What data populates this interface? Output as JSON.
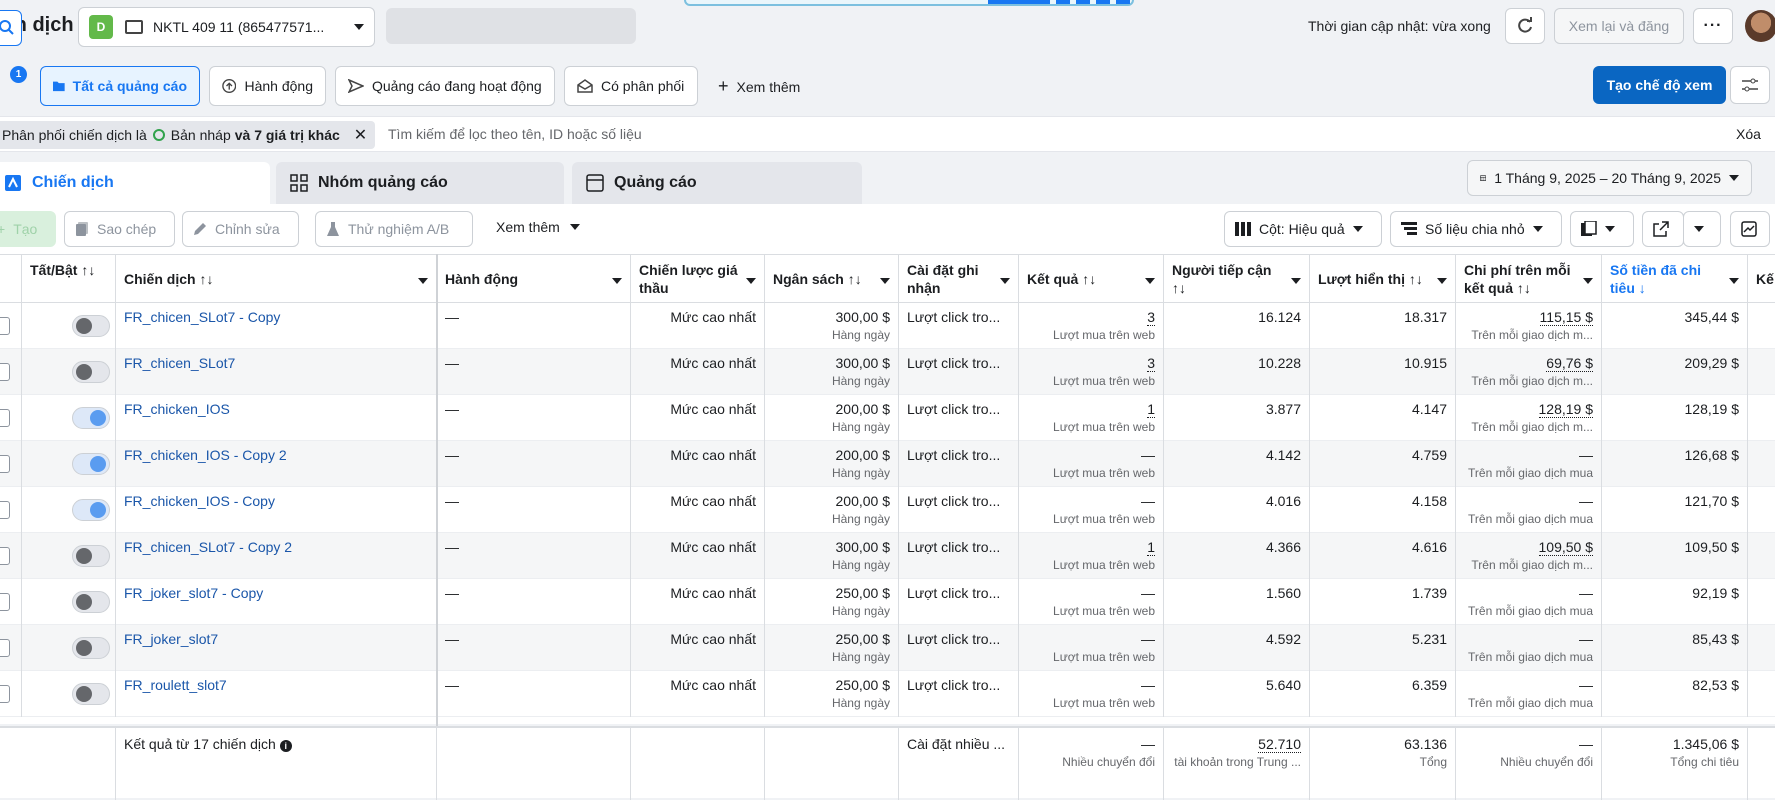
{
  "header": {
    "title": "iến dịch",
    "account_badge": "D",
    "account_name": "NKTL 409 11 (865477571...",
    "updated_text": "Thời gian cập nhật: vừa xong",
    "review_label": "Xem lại và đăng"
  },
  "toolbar": {
    "notif_count": "1",
    "chips": [
      "Tất cả quảng cáo",
      "Hành động",
      "Quảng cáo đang hoạt động",
      "Có phân phối"
    ],
    "more_label": "Xem thêm",
    "create_view_label": "Tạo chế độ xem"
  },
  "filter": {
    "text": "Phân phối chiến dịch là",
    "value": "Bản nháp",
    "extra": "và 7 giá trị khác",
    "search_placeholder": "Tìm kiếm để lọc theo tên, ID hoặc số liệu",
    "clear_label": "Xóa"
  },
  "tabs": [
    "Chiến dịch",
    "Nhóm quảng cáo",
    "Quảng cáo"
  ],
  "date_range": "1 Tháng 9, 2025 – 20 Tháng 9, 2025",
  "actions": {
    "create": "Tạo",
    "copy": "Sao chép",
    "edit": "Chỉnh sửa",
    "ab_test": "Thử nghiệm A/B",
    "more": "Xem thêm",
    "columns": "Cột: Hiệu quả",
    "breakdown": "Số liệu chia nhỏ"
  },
  "columns": {
    "toggle": "Tất/Bật ↑↓",
    "campaign": "Chiến dịch ↑↓",
    "action": "Hành động",
    "bid": "Chiến lược giá thầu",
    "budget": "Ngân sách ↑↓",
    "attribution": "Cài đặt ghi nhận",
    "results": "Kết quả ↑↓",
    "reach": "Người tiếp cận ↑↓",
    "impressions": "Lượt hiển thị ↑↓",
    "cpr": "Chi phí trên mỗi kết quả ↑↓",
    "spent": "Số tiền đã chi tiêu ↓",
    "next": "Kế"
  },
  "rows": [
    {
      "name": "FR_chicen_SLot7 - Copy",
      "on": false,
      "action": "—",
      "bid": "Mức cao nhất",
      "budget": "300,00 $",
      "budget_sub": "Hàng ngày",
      "attr": "Lượt click tro...",
      "result": "3",
      "result_sub": "Lượt mua trên web",
      "reach": "16.124",
      "impr": "18.317",
      "cpr": "115,15 $",
      "cpr_sub": "Trên mỗi giao dịch m...",
      "spent": "345,44 $"
    },
    {
      "name": "FR_chicen_SLot7",
      "on": false,
      "action": "—",
      "bid": "Mức cao nhất",
      "budget": "300,00 $",
      "budget_sub": "Hàng ngày",
      "attr": "Lượt click tro...",
      "result": "3",
      "result_sub": "Lượt mua trên web",
      "reach": "10.228",
      "impr": "10.915",
      "cpr": "69,76 $",
      "cpr_sub": "Trên mỗi giao dịch m...",
      "spent": "209,29 $"
    },
    {
      "name": "FR_chicken_IOS",
      "on": true,
      "action": "—",
      "bid": "Mức cao nhất",
      "budget": "200,00 $",
      "budget_sub": "Hàng ngày",
      "attr": "Lượt click tro...",
      "result": "1",
      "result_sub": "Lượt mua trên web",
      "reach": "3.877",
      "impr": "4.147",
      "cpr": "128,19 $",
      "cpr_sub": "Trên mỗi giao dịch m...",
      "spent": "128,19 $"
    },
    {
      "name": "FR_chicken_IOS - Copy 2",
      "on": true,
      "action": "—",
      "bid": "Mức cao nhất",
      "budget": "200,00 $",
      "budget_sub": "Hàng ngày",
      "attr": "Lượt click tro...",
      "result": "—",
      "result_sub": "Lượt mua trên web",
      "reach": "4.142",
      "impr": "4.759",
      "cpr": "—",
      "cpr_sub": "Trên mỗi giao dịch mua",
      "spent": "126,68 $"
    },
    {
      "name": "FR_chicken_IOS - Copy",
      "on": true,
      "action": "—",
      "bid": "Mức cao nhất",
      "budget": "200,00 $",
      "budget_sub": "Hàng ngày",
      "attr": "Lượt click tro...",
      "result": "—",
      "result_sub": "Lượt mua trên web",
      "reach": "4.016",
      "impr": "4.158",
      "cpr": "—",
      "cpr_sub": "Trên mỗi giao dịch mua",
      "spent": "121,70 $"
    },
    {
      "name": "FR_chicen_SLot7 - Copy 2",
      "on": false,
      "action": "—",
      "bid": "Mức cao nhất",
      "budget": "300,00 $",
      "budget_sub": "Hàng ngày",
      "attr": "Lượt click tro...",
      "result": "1",
      "result_sub": "Lượt mua trên web",
      "reach": "4.366",
      "impr": "4.616",
      "cpr": "109,50 $",
      "cpr_sub": "Trên mỗi giao dịch m...",
      "spent": "109,50 $"
    },
    {
      "name": "FR_joker_slot7 - Copy",
      "on": false,
      "action": "—",
      "bid": "Mức cao nhất",
      "budget": "250,00 $",
      "budget_sub": "Hàng ngày",
      "attr": "Lượt click tro...",
      "result": "—",
      "result_sub": "Lượt mua trên web",
      "reach": "1.560",
      "impr": "1.739",
      "cpr": "—",
      "cpr_sub": "Trên mỗi giao dịch mua",
      "spent": "92,19 $"
    },
    {
      "name": "FR_joker_slot7",
      "on": false,
      "action": "—",
      "bid": "Mức cao nhất",
      "budget": "250,00 $",
      "budget_sub": "Hàng ngày",
      "attr": "Lượt click tro...",
      "result": "—",
      "result_sub": "Lượt mua trên web",
      "reach": "4.592",
      "impr": "5.231",
      "cpr": "—",
      "cpr_sub": "Trên mỗi giao dịch mua",
      "spent": "85,43 $"
    },
    {
      "name": "FR_roulett_slot7",
      "on": false,
      "action": "—",
      "bid": "Mức cao nhất",
      "budget": "250,00 $",
      "budget_sub": "Hàng ngày",
      "attr": "Lượt click tro...",
      "result": "—",
      "result_sub": "Lượt mua trên web",
      "reach": "5.640",
      "impr": "6.359",
      "cpr": "—",
      "cpr_sub": "Trên mỗi giao dịch mua",
      "spent": "82,53 $"
    }
  ],
  "footer": {
    "summary": "Kết quả từ 17 chiến dịch",
    "attr": "Cài đặt nhiều ...",
    "results": "—",
    "results_sub": "Nhiều chuyển đổi",
    "reach": "52.710",
    "reach_sub": "tài khoản trong Trung ...",
    "impr": "63.136",
    "impr_sub": "Tổng",
    "cpr": "—",
    "cpr_sub": "Nhiều chuyển đổi",
    "spent": "1.345,06 $",
    "spent_sub": "Tổng chi tiêu"
  }
}
